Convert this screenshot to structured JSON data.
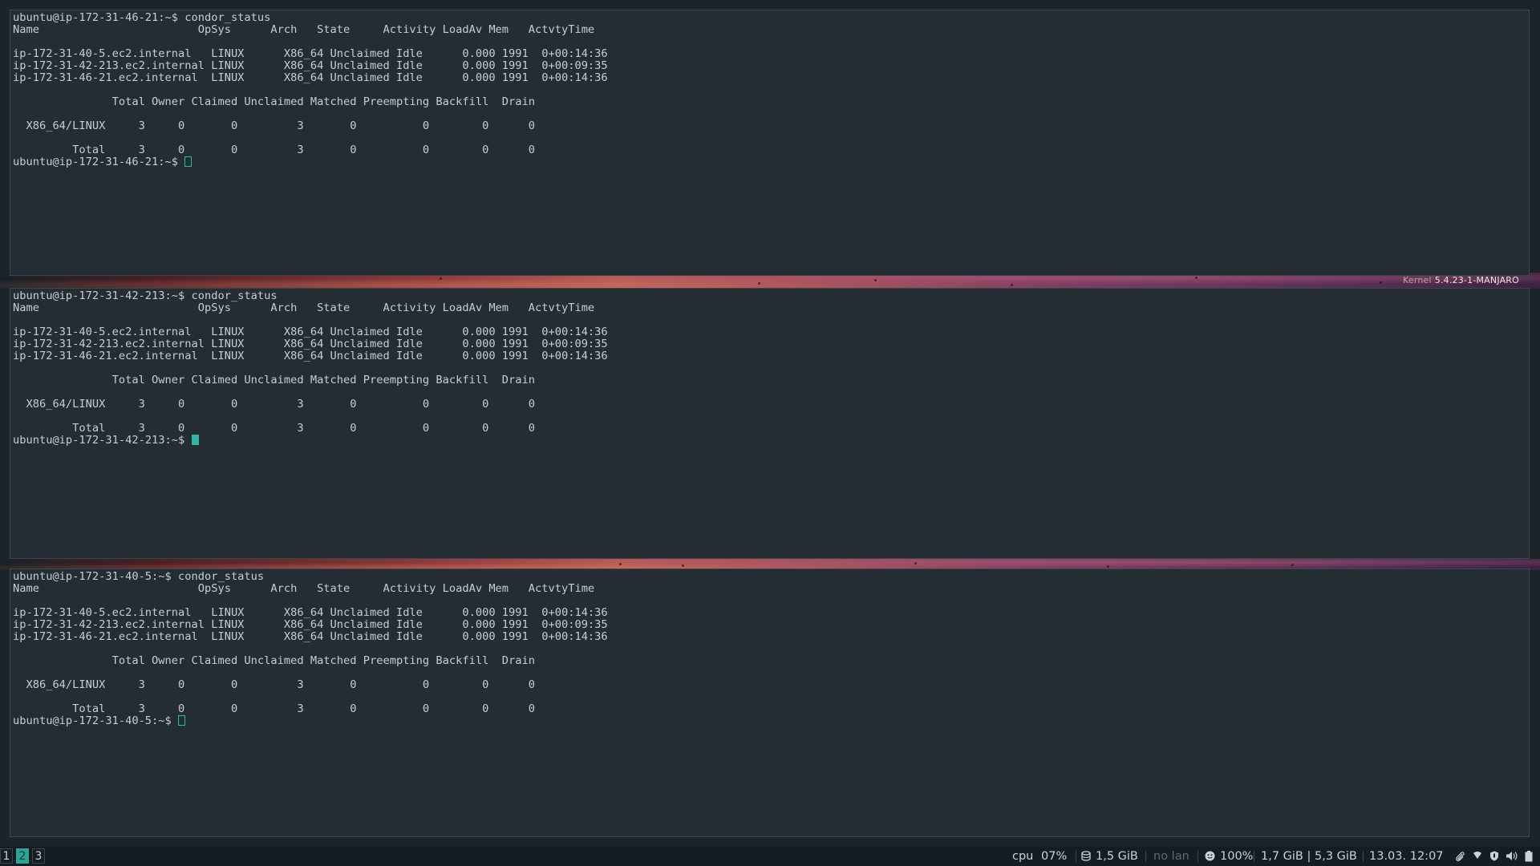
{
  "wallpaper": {
    "kernel_label": "Kernel",
    "kernel_version": "5.4.23-1-MANJARO"
  },
  "terminals": [
    {
      "lines": [
        "ubuntu@ip-172-31-46-21:~$ condor_status",
        "Name                        OpSys      Arch   State     Activity LoadAv Mem   ActvtyTime",
        "",
        "ip-172-31-40-5.ec2.internal   LINUX      X86_64 Unclaimed Idle      0.000 1991  0+00:14:36",
        "ip-172-31-42-213.ec2.internal LINUX      X86_64 Unclaimed Idle      0.000 1991  0+00:09:35",
        "ip-172-31-46-21.ec2.internal  LINUX      X86_64 Unclaimed Idle      0.000 1991  0+00:14:36",
        "",
        "               Total Owner Claimed Unclaimed Matched Preempting Backfill  Drain",
        "",
        "  X86_64/LINUX     3     0       0         3       0          0        0      0",
        "",
        "         Total     3     0       0         3       0          0        0      0"
      ],
      "prompt": "ubuntu@ip-172-31-46-21:~$ ",
      "cursor_active": false
    },
    {
      "lines": [
        "ubuntu@ip-172-31-42-213:~$ condor_status",
        "Name                        OpSys      Arch   State     Activity LoadAv Mem   ActvtyTime",
        "",
        "ip-172-31-40-5.ec2.internal   LINUX      X86_64 Unclaimed Idle      0.000 1991  0+00:14:36",
        "ip-172-31-42-213.ec2.internal LINUX      X86_64 Unclaimed Idle      0.000 1991  0+00:09:35",
        "ip-172-31-46-21.ec2.internal  LINUX      X86_64 Unclaimed Idle      0.000 1991  0+00:14:36",
        "",
        "               Total Owner Claimed Unclaimed Matched Preempting Backfill  Drain",
        "",
        "  X86_64/LINUX     3     0       0         3       0          0        0      0",
        "",
        "         Total     3     0       0         3       0          0        0      0"
      ],
      "prompt": "ubuntu@ip-172-31-42-213:~$ ",
      "cursor_active": true
    },
    {
      "lines": [
        "ubuntu@ip-172-31-40-5:~$ condor_status",
        "Name                        OpSys      Arch   State     Activity LoadAv Mem   ActvtyTime",
        "",
        "ip-172-31-40-5.ec2.internal   LINUX      X86_64 Unclaimed Idle      0.000 1991  0+00:14:36",
        "ip-172-31-42-213.ec2.internal LINUX      X86_64 Unclaimed Idle      0.000 1991  0+00:09:35",
        "ip-172-31-46-21.ec2.internal  LINUX      X86_64 Unclaimed Idle      0.000 1991  0+00:14:36",
        "",
        "               Total Owner Claimed Unclaimed Matched Preempting Backfill  Drain",
        "",
        "  X86_64/LINUX     3     0       0         3       0          0        0      0",
        "",
        "         Total     3     0       0         3       0          0        0      0"
      ],
      "prompt": "ubuntu@ip-172-31-40-5:~$ ",
      "cursor_active": false
    }
  ],
  "taskbar": {
    "workspaces": [
      "1",
      "2",
      "3"
    ],
    "active_workspace": "2",
    "cpu_label": "cpu",
    "cpu_value": "07%",
    "disk_value": "1,5 GiB",
    "network": "no lan",
    "battery": "100%",
    "memory": "1,7 GiB | 5,3 GiB",
    "datetime": "13.03. 12:07",
    "icons": [
      "disk-icon",
      "battery-icon",
      "attachment-icon",
      "wifi-icon",
      "shield-icon",
      "volume-icon",
      "power-icon"
    ]
  },
  "colors": {
    "terminal_bg": "#232d33",
    "terminal_fg": "#c6ced2",
    "accent": "#2aa595",
    "bar_bg": "#161d22"
  }
}
